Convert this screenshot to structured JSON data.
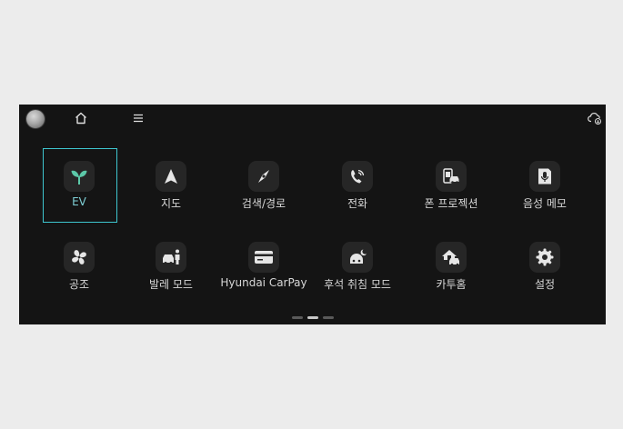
{
  "apps": [
    {
      "label": "EV",
      "icon": "sprout-icon",
      "selected": true
    },
    {
      "label": "지도",
      "icon": "navigation-arrow-icon"
    },
    {
      "label": "검색/경로",
      "icon": "compass-icon"
    },
    {
      "label": "전화",
      "icon": "phone-icon"
    },
    {
      "label": "폰 프로젝션",
      "icon": "phone-projection-icon"
    },
    {
      "label": "음성 메모",
      "icon": "voice-memo-icon"
    },
    {
      "label": "공조",
      "icon": "fan-icon"
    },
    {
      "label": "발레 모드",
      "icon": "valet-mode-icon"
    },
    {
      "label": "Hyundai CarPay",
      "icon": "card-icon"
    },
    {
      "label": "후석 취침 모드",
      "icon": "rear-sleep-icon"
    },
    {
      "label": "카투홈",
      "icon": "car-to-home-icon"
    },
    {
      "label": "설정",
      "icon": "gear-icon"
    }
  ],
  "colors": {
    "accent": "#3ec6cf",
    "ev_icon": "#5cc8a8",
    "background": "#141414",
    "tile_icon_bg": "#262626"
  },
  "pager": {
    "pages": 3,
    "current": 2
  }
}
